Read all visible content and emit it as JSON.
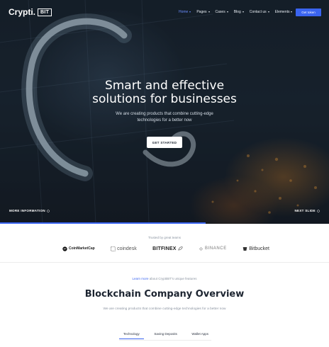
{
  "header": {
    "logo_text": "Crypti.",
    "logo_badge": "BIT",
    "nav": [
      {
        "label": "Home",
        "active": true
      },
      {
        "label": "Pages",
        "active": false
      },
      {
        "label": "Cases",
        "active": false
      },
      {
        "label": "Blog",
        "active": false
      },
      {
        "label": "Contact us",
        "active": false
      },
      {
        "label": "Elements",
        "active": false
      }
    ],
    "cta_label": "Get token"
  },
  "hero": {
    "title_line1": "Smart and effective",
    "title_line2": "solutions for businesses",
    "subtitle_line1": "We are creating products that combine cutting-edge",
    "subtitle_line2": "technologies for a better now",
    "button_label": "GET STARTED",
    "more_info": "MORE INFORMATION",
    "next_slide": "NEXT SLIDE",
    "slide_progress": 0.625
  },
  "trusted": {
    "caption": "Trusted by great teams",
    "partners": [
      "CoinMarketCap",
      "coindesk",
      "BITFINEX",
      "BINANCE",
      "Bitbucket"
    ]
  },
  "overview": {
    "learn_link": "Learn more",
    "learn_rest": " about CryptiBIT's unique features",
    "title": "Blockchain Company Overview",
    "subtitle": "We are creating products that combine cutting-edge technologies for a better now",
    "tabs": [
      {
        "label": "Technology",
        "active": true
      },
      {
        "label": "Saving Deposits",
        "active": false
      },
      {
        "label": "Wallet Apps",
        "active": false
      }
    ]
  },
  "colors": {
    "accent": "#3a64f0",
    "nav_active": "#6a8dff",
    "hero_bg": "#1a2530"
  }
}
